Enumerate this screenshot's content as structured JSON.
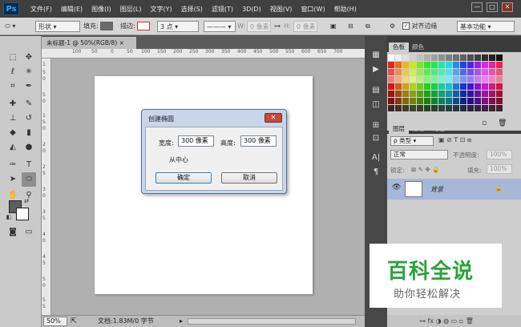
{
  "menubar": {
    "logo": "Ps",
    "items": [
      "文件(F)",
      "编辑(E)",
      "图像(I)",
      "图层(L)",
      "文字(Y)",
      "选择(S)",
      "滤镜(T)",
      "3D(D)",
      "视图(V)",
      "窗口(W)",
      "帮助(H)"
    ],
    "minimize": "—",
    "restore": "□",
    "close": "✕"
  },
  "options": {
    "shape_mode": "形状",
    "fill_label": "填充:",
    "stroke_label": "描边:",
    "stroke_size": "3 点",
    "w_label": "W:",
    "w_value": "0 像素",
    "h_label": "H:",
    "h_value": "0 像素",
    "align_edges": "对齐边缘",
    "workspace": "基本功能",
    "fill_color": "#6a6a6a",
    "stroke_color": "#e05050"
  },
  "document": {
    "tab": "未标题-1 @ 50%(RGB/8)",
    "tab_close": "×",
    "ruler_h": [
      "100",
      "50",
      "0",
      "50",
      "100",
      "150",
      "200",
      "250",
      "300",
      "350",
      "400",
      "450",
      "500",
      "550",
      "600",
      "650",
      "700"
    ],
    "ruler_v": [
      "1",
      "5",
      "0",
      "5",
      "0",
      "1",
      "5",
      "0",
      "2",
      "0",
      "2",
      "5",
      "3",
      "0",
      "3",
      "5",
      "4",
      "0",
      "4",
      "5",
      "5",
      "0",
      "5",
      "5"
    ]
  },
  "status": {
    "zoom": "50%",
    "doc_info": "文档:1.83M/0 字节"
  },
  "swatches_panel": {
    "tabs": [
      "色板",
      "颜色"
    ]
  },
  "layers_panel": {
    "tabs": [
      "图层",
      "通道",
      "路径"
    ],
    "kind_filter": "ρ 类型",
    "blend_mode": "正常",
    "opacity_label": "不透明度:",
    "opacity_value": "100%",
    "lock_label": "锁定:",
    "fill_label": "填充:",
    "fill_value": "100%",
    "layer_name": "背景"
  },
  "dialog": {
    "title": "创建椭圆",
    "width_label": "宽度:",
    "width_value": "300 像素",
    "height_label": "高度:",
    "height_value": "300 像素",
    "from_center": "从中心",
    "ok": "确定",
    "cancel": "取消"
  },
  "watermark": {
    "main": "百科全说",
    "sub": "助你轻松解决"
  }
}
